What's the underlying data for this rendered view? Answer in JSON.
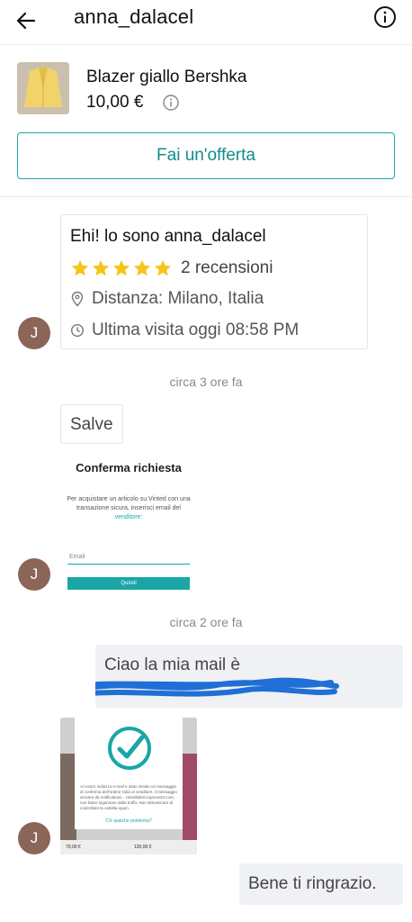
{
  "header": {
    "title": "anna_dalacel",
    "back_icon": "arrow-left-icon",
    "info_icon": "info-circle-icon"
  },
  "product": {
    "name": "Blazer giallo Bershka",
    "price": "10,00 €",
    "offer_label": "Fai un'offerta"
  },
  "profile_card": {
    "title": "Ehi! lo sono anna_dalacel",
    "rating": 5,
    "reviews": "2 recensioni",
    "distance": "Distanza: Milano, Italia",
    "last_seen": "Ultima visita oggi 08:58 PM"
  },
  "avatar_initial": "J",
  "messages": {
    "ts1": "circa 3 ore fa",
    "salve": "Salve",
    "image1": {
      "title": "Conferma richiesta",
      "body": "Per acquistare un articolo su Vinted con una transazione sicura, inserisci email del",
      "link": "venditore:",
      "email_label": "Email",
      "button": "Quindi"
    },
    "ts2": "circa 2 ore fa",
    "outgoing1": "Ciao la mia mail è",
    "image2": {
      "body": "Al vostro indirizzo e-mail e stato inviato un messaggio di conferma dell'ordine Odia al venditore, il messaggio arrivera da notifications - vintedlabel.express24.com, non fatevi ingannare dalla truffa. Non dimenticare di controllare la cartella spam.",
      "link": "C'è qualche problema?",
      "price_left": "70,00 €",
      "price_right": "120,00 €"
    },
    "outgoing2": "Bene ti ringrazio."
  },
  "colors": {
    "accent": "#1aa6a6",
    "star": "#f5c518",
    "avatar": "#8a6558",
    "outgoing_bubble": "#eff1f4",
    "scribble": "#1f6fd6"
  }
}
